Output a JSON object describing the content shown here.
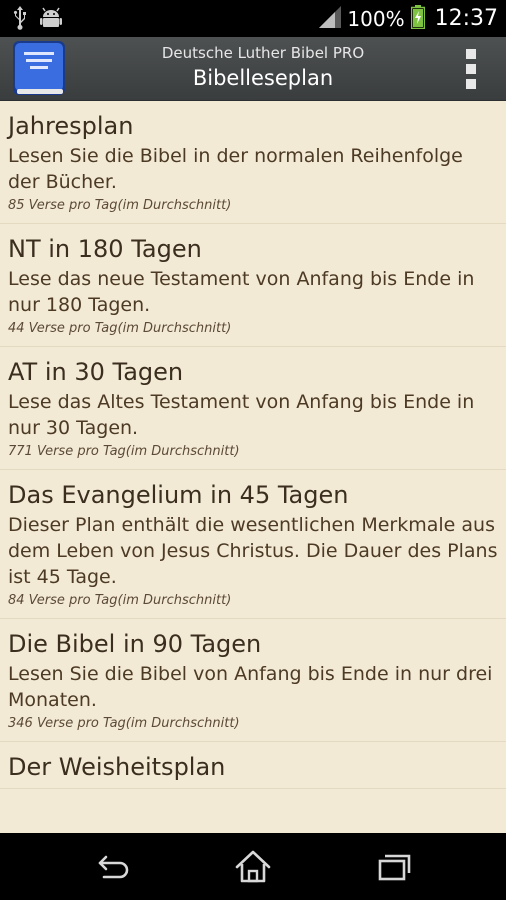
{
  "status_bar": {
    "battery_percent": "100%",
    "time": "12:37",
    "icons": [
      "usb-icon",
      "android-debug-icon",
      "signal-icon",
      "battery-charging-icon"
    ]
  },
  "action_bar": {
    "app_icon": "bible-book-icon",
    "app_title": "Deutsche Luther Bibel PRO",
    "screen_title": "Bibelleseplan",
    "menu_icon": "overflow-menu-icon"
  },
  "plans": [
    {
      "title": "Jahresplan",
      "description": "Lesen Sie die Bibel in der normalen Reihenfolge der Bücher.",
      "meta": "85 Verse pro Tag(im Durchschnitt)"
    },
    {
      "title": "NT in 180 Tagen",
      "description": "Lese das neue Testament von Anfang bis Ende in nur 180 Tagen.",
      "meta": "44 Verse pro Tag(im Durchschnitt)"
    },
    {
      "title": "AT in 30 Tagen",
      "description": "Lese das Altes Testament von Anfang bis Ende in nur 30 Tagen.",
      "meta": "771 Verse pro Tag(im Durchschnitt)"
    },
    {
      "title": "Das Evangelium in 45 Tagen",
      "description": "Dieser Plan enthält die wesentlichen Merkmale aus dem Leben von Jesus Christus. Die Dauer des Plans ist 45 Tage.",
      "meta": "84 Verse pro Tag(im Durchschnitt)"
    },
    {
      "title": "Die Bibel in 90 Tagen",
      "description": "Lesen Sie die Bibel von Anfang bis Ende in nur drei Monaten.",
      "meta": "346 Verse pro Tag(im Durchschnitt)"
    },
    {
      "title": "Der Weisheitsplan",
      "description": "",
      "meta": ""
    }
  ],
  "nav_bar": {
    "icons": [
      "back-icon",
      "home-icon",
      "recent-apps-icon"
    ]
  },
  "colors": {
    "content_background": "#f3ead6",
    "action_bar": "#45484a",
    "text": "#3b2e1e"
  }
}
